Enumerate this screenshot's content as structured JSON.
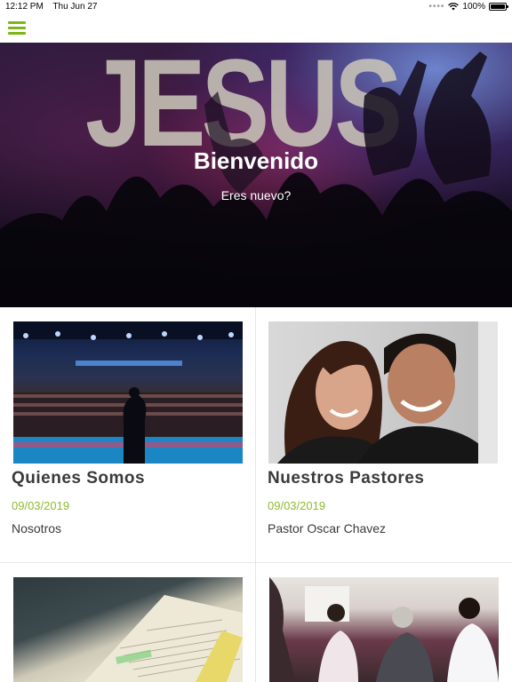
{
  "status_bar": {
    "time": "12:12 PM",
    "date": "Thu Jun 27",
    "battery": "100%",
    "battery_level": 1.0
  },
  "nav": {
    "menu_icon": "hamburger-menu-icon",
    "accent": "#7cb518"
  },
  "hero": {
    "background_word": "JESUS",
    "title": "Bienvenido",
    "subtitle": "Eres nuevo?"
  },
  "cards": [
    {
      "title": "Quienes Somos",
      "date": "09/03/2019",
      "description": "Nosotros"
    },
    {
      "title": "Nuestros Pastores",
      "date": "09/03/2019",
      "description": "Pastor Oscar Chavez"
    },
    {
      "title": "",
      "date": "",
      "description": ""
    },
    {
      "title": "",
      "date": "",
      "description": ""
    }
  ],
  "colors": {
    "date_green": "#8dbb2f",
    "title_text": "#3a3a3a"
  }
}
